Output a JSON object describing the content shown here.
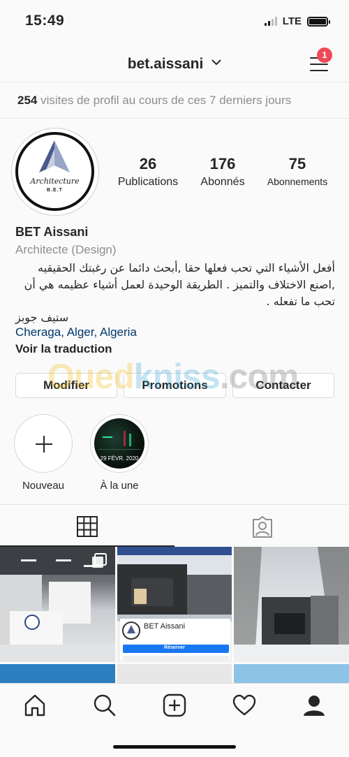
{
  "status": {
    "time": "15:49",
    "network": "LTE"
  },
  "header": {
    "username": "bet.aissani",
    "notification_count": "1"
  },
  "insights": {
    "count": "254",
    "text": " visites de profil au cours de ces 7 derniers jours"
  },
  "avatar": {
    "logo_word": "Architecture",
    "logo_sub": "B.E.T"
  },
  "stats": [
    {
      "value": "26",
      "label": "Publications"
    },
    {
      "value": "176",
      "label": "Abonnés"
    },
    {
      "value": "75",
      "label": "Abonnements"
    }
  ],
  "bio": {
    "name": "BET Aissani",
    "category": "Architecte (Design)",
    "text": "أفعل الأشياء التي تحب فعلها حقا ,أبحث دائما عن رغبتك الحقيقيه ,اصنع الاختلاف والتميز . الطريقة الوحيدة لعمل أشياء عظيمه هي أن تحب ما تفعله .",
    "signature": "ستيف جوبز",
    "location": "Cheraga, Alger, Algeria",
    "translate": "Voir la traduction"
  },
  "watermark": {
    "part1": "Oued",
    "part2": "kniss",
    "part3": ".com"
  },
  "buttons": {
    "edit": "Modifier",
    "promotions": "Promotions",
    "contact": "Contacter"
  },
  "highlights": [
    {
      "label": "Nouveau"
    },
    {
      "label": "À la une",
      "date": "29 FÉVR. 2020"
    }
  ],
  "post_preview": {
    "page_name": "BET Aissani",
    "action": "Réserver"
  },
  "colors": {
    "accent_link": "#00376b",
    "notification": "#ed4956",
    "border": "#dbdbdb"
  },
  "icons": [
    "home-icon",
    "search-icon",
    "add-post-icon",
    "heart-icon",
    "profile-icon",
    "grid-icon",
    "tagged-icon"
  ]
}
